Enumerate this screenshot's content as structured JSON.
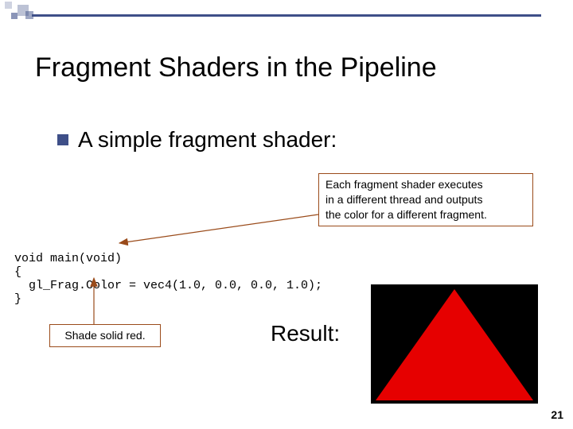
{
  "title": "Fragment Shaders in the Pipeline",
  "bullet": "A simple fragment shader:",
  "callout_right_l1": "Each fragment shader executes",
  "callout_right_l2": "in a different thread and outputs",
  "callout_right_l3": "the color for a different fragment.",
  "code_l1": "void main(void)",
  "code_l2": "{",
  "code_l3": "  gl_Frag.Color = vec4(1.0, 0.0, 0.0, 1.0);",
  "code_l4": "}",
  "callout_bottom": "Shade solid red.",
  "result_label": "Result:",
  "page_number": "21"
}
